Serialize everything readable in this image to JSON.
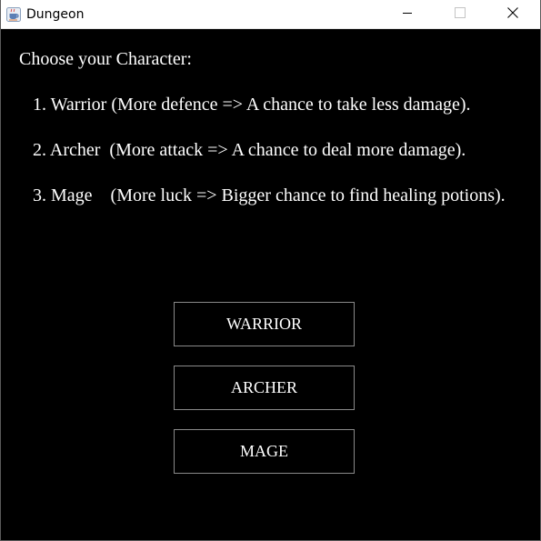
{
  "window": {
    "title": "Dungeon",
    "icon": "java-cup-icon",
    "controls": {
      "minimize": "minimize-icon",
      "maximize": "maximize-icon",
      "close": "close-icon"
    }
  },
  "content": {
    "heading": "Choose your Character:",
    "descriptions": [
      "1. Warrior (More defence => A chance to take less damage).",
      "2. Archer  (More attack => A chance to deal more damage).",
      "3. Mage    (More luck => Bigger chance to find healing potions)."
    ],
    "buttons": {
      "warrior": "WARRIOR",
      "archer": "ARCHER",
      "mage": "MAGE"
    }
  },
  "colors": {
    "background": "#000000",
    "text": "#ffffff",
    "button_border": "#8a8a8a",
    "titlebar": "#ffffff"
  }
}
